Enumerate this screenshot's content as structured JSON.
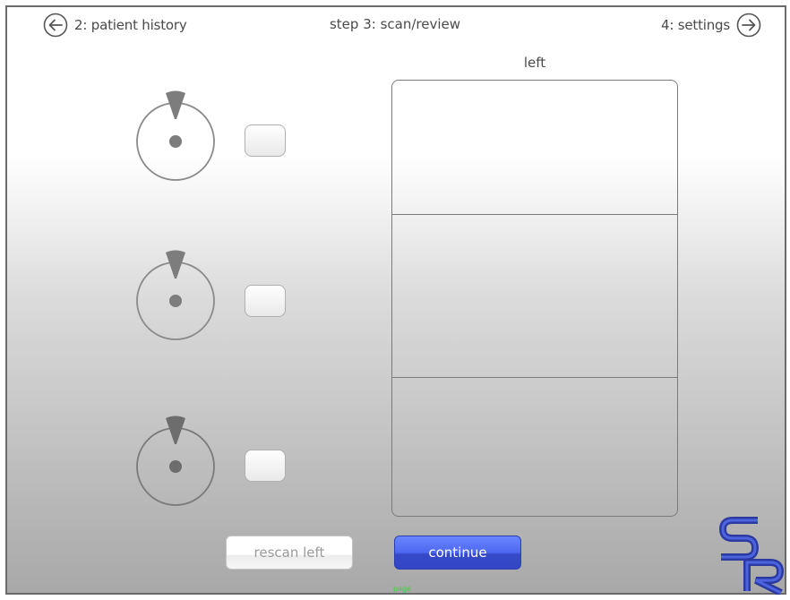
{
  "nav": {
    "prev_label": "2: patient history",
    "step_title": "step 3: scan/review",
    "next_label": "4: settings"
  },
  "scan": {
    "side_label": "left"
  },
  "actions": {
    "rescan_label": "rescan left",
    "continue_label": "continue"
  },
  "logo": {
    "letters": "SR",
    "color": "#2b3aa0"
  },
  "footer": {
    "page_tag": "page"
  },
  "colors": {
    "accent": "#4d68f0",
    "frame_border": "#6a6a6a",
    "text": "#4a4a4a"
  }
}
